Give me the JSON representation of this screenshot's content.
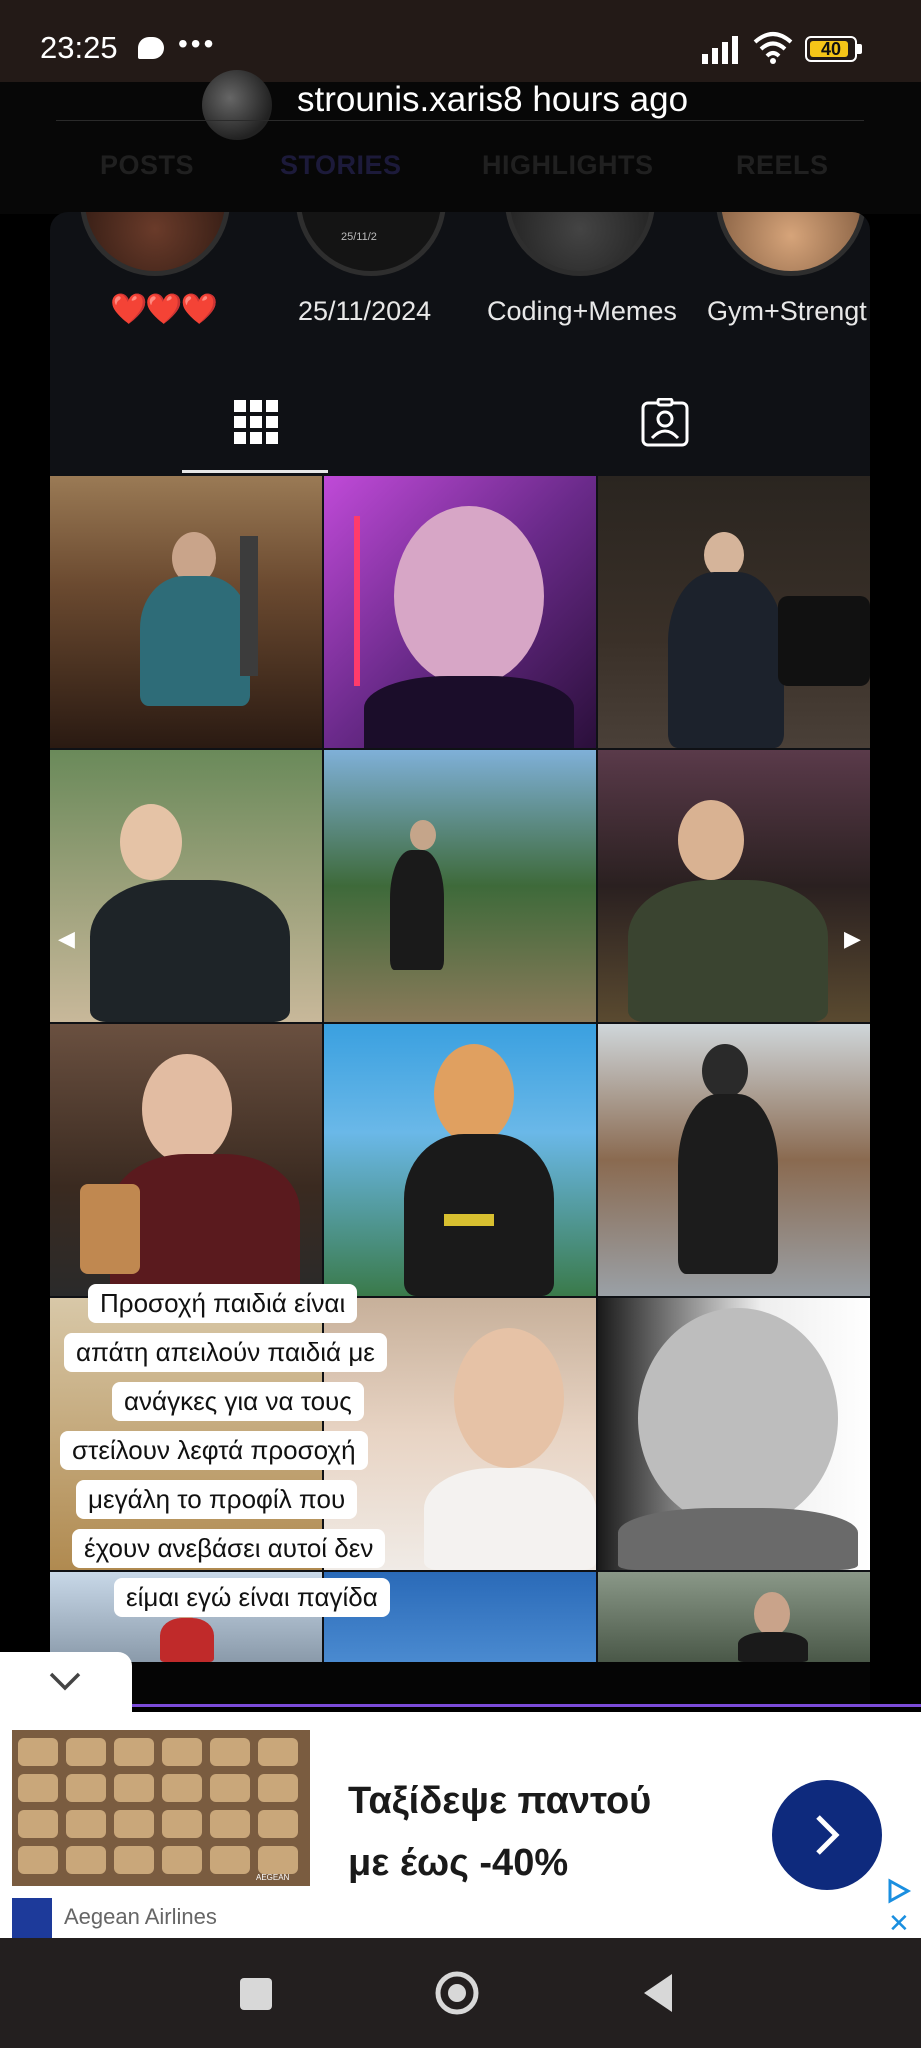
{
  "status_bar": {
    "time": "23:25",
    "dots": "•••",
    "battery": "40"
  },
  "header": {
    "username_time": "strounis.xaris8 hours ago"
  },
  "profile_tabs": [
    "POSTS",
    "STORIES",
    "HIGHLIGHTS",
    "REELS"
  ],
  "highlights": [
    {
      "label": "❤️❤️❤️"
    },
    {
      "label": "25/11/2024"
    },
    {
      "label": "Coding+Memes"
    },
    {
      "label": "Gym+Strengt"
    }
  ],
  "content_tabs": {
    "grid_icon": "grid-icon",
    "tagged_icon": "tagged-person-icon"
  },
  "overlay_warning": {
    "lines": [
      "Προσοχή παιδιά είναι",
      "απάτη απειλούν παιδιά με",
      "ανάγκες για να τους",
      "στείλουν λεφτά προσοχή",
      "μεγάλη το προφίλ που",
      "έχουν ανεβάσει αυτοί δεν",
      "είμαι εγώ είναι παγίδα"
    ]
  },
  "ad": {
    "headline_line1": "Ταξίδεψε παντού",
    "headline_line2": "με έως -40%",
    "brand": "Aegean Airlines",
    "close_label": "✕",
    "image_caption": "AEGEAN"
  },
  "colors": {
    "accent_purple": "#7b4bd8",
    "ad_cta": "#0e2a7d",
    "heart_red": "#e0332f"
  }
}
